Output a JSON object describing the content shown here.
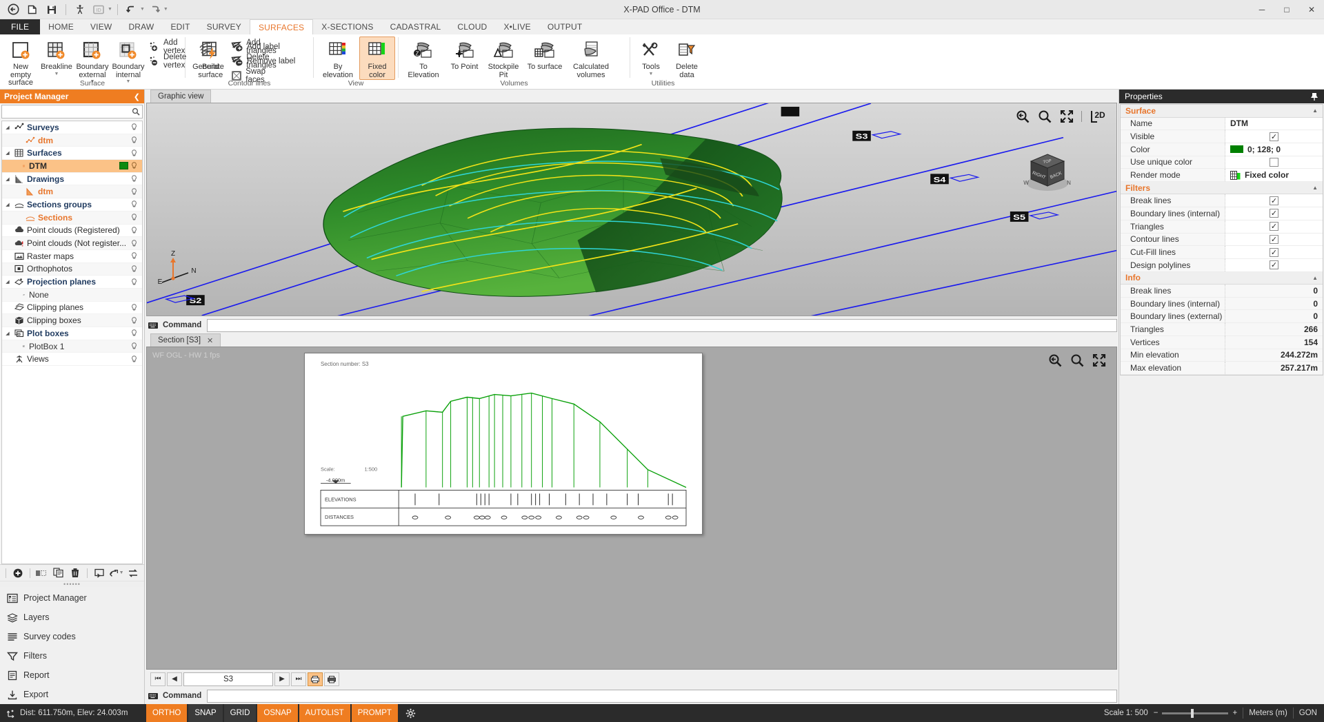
{
  "window": {
    "title": "X-PAD Office - DTM",
    "minimize": "─",
    "maximize": "□",
    "close": "✕"
  },
  "quick_access": [
    {
      "name": "back-icon",
      "label": "Back"
    },
    {
      "name": "new-file-icon",
      "label": "New"
    },
    {
      "name": "save-icon",
      "label": "Save"
    },
    {
      "name": "surveyor-icon",
      "label": "Survey"
    },
    {
      "name": "id-icon",
      "label": "ID"
    },
    {
      "name": "undo-icon",
      "label": "Undo"
    },
    {
      "name": "redo-icon",
      "label": "Redo"
    }
  ],
  "ribbon": {
    "tabs": [
      {
        "label": "FILE",
        "active": false,
        "file": true
      },
      {
        "label": "HOME",
        "active": false
      },
      {
        "label": "VIEW",
        "active": false
      },
      {
        "label": "DRAW",
        "active": false
      },
      {
        "label": "EDIT",
        "active": false
      },
      {
        "label": "SURVEY",
        "active": false
      },
      {
        "label": "SURFACES",
        "active": true
      },
      {
        "label": "X-SECTIONS",
        "active": false
      },
      {
        "label": "CADASTRAL",
        "active": false
      },
      {
        "label": "CLOUD",
        "active": false
      },
      {
        "label": "X•LIVE",
        "active": false
      },
      {
        "label": "OUTPUT",
        "active": false
      }
    ],
    "groups": [
      {
        "label": "Surface",
        "big": [
          {
            "label": "New empty surface",
            "icon": "new-empty-surface-icon",
            "selected": false
          },
          {
            "label": "Breakline",
            "icon": "breakline-icon",
            "dropdown": true,
            "selected": false
          },
          {
            "label": "Boundary external",
            "icon": "boundary-external-icon",
            "dropdown": true,
            "selected": false
          },
          {
            "label": "Boundary internal",
            "icon": "boundary-internal-icon",
            "dropdown": true,
            "selected": false
          }
        ],
        "small": [
          {
            "label": "Add vertex",
            "icon": "add-vertex-icon"
          },
          {
            "label": "Delete vertex",
            "icon": "delete-vertex-icon"
          }
        ],
        "big2": [
          {
            "label": "Build surface",
            "icon": "build-surface-icon",
            "selected": false
          }
        ],
        "small2": [
          {
            "label": "Add triangles",
            "icon": "add-triangles-icon"
          },
          {
            "label": "Delete triangles",
            "icon": "delete-triangles-icon"
          },
          {
            "label": "Swap faces",
            "icon": "swap-faces-icon"
          }
        ]
      },
      {
        "label": "Contour lines",
        "big": [
          {
            "label": "Generate",
            "icon": "generate-contours-icon",
            "selected": false
          }
        ],
        "small": [
          {
            "label": "Add label",
            "icon": "add-label-icon"
          },
          {
            "label": "Remove label",
            "icon": "remove-label-icon"
          }
        ]
      },
      {
        "label": "View",
        "big": [
          {
            "label": "By elevation",
            "icon": "by-elevation-icon",
            "selected": false
          },
          {
            "label": "Fixed color",
            "icon": "fixed-color-icon",
            "selected": true
          }
        ]
      },
      {
        "label": "Volumes",
        "big": [
          {
            "label": "To Elevation",
            "icon": "to-elevation-icon",
            "selected": false
          },
          {
            "label": "To Point",
            "icon": "to-point-icon",
            "selected": false
          },
          {
            "label": "Stockpile Pit",
            "icon": "stockpile-pit-icon",
            "selected": false
          },
          {
            "label": "To surface",
            "icon": "to-surface-icon",
            "selected": false
          },
          {
            "label": "Calculated volumes",
            "icon": "calculated-volumes-icon",
            "selected": false
          }
        ]
      },
      {
        "label": "Utilities",
        "big": [
          {
            "label": "Tools",
            "icon": "tools-icon",
            "dropdown": true,
            "selected": false
          },
          {
            "label": "Delete data",
            "icon": "delete-data-icon",
            "selected": false
          }
        ]
      }
    ]
  },
  "project_manager": {
    "title": "Project Manager",
    "collapse_icon": "chevron-left-icon",
    "search_placeholder": "",
    "search_icon": "search-icon",
    "tree": [
      {
        "label": "Surveys",
        "icon": "surveys-icon",
        "group": true,
        "expanded": true,
        "bulb": true
      },
      {
        "label": "dtm",
        "icon": "survey-item-icon",
        "child": true,
        "bulb": true
      },
      {
        "label": "Surfaces",
        "icon": "surfaces-icon",
        "group": true,
        "expanded": true,
        "bulb": true
      },
      {
        "label": "DTM",
        "icon": "surface-item-icon",
        "child": true,
        "selected": true,
        "swatch": "#008000",
        "bulb": true
      },
      {
        "label": "Drawings",
        "icon": "drawings-icon",
        "group": true,
        "expanded": true,
        "bulb": true
      },
      {
        "label": "dtm",
        "icon": "drawing-item-icon",
        "child": true,
        "bulb": true
      },
      {
        "label": "Sections groups",
        "icon": "sections-groups-icon",
        "group": true,
        "expanded": true,
        "bulb": true
      },
      {
        "label": "Sections",
        "icon": "sections-item-icon",
        "child": true,
        "bulb": true
      },
      {
        "label": "Point clouds (Registered)",
        "icon": "point-cloud-registered-icon",
        "bulb": true
      },
      {
        "label": "Point clouds (Not register...",
        "icon": "point-cloud-unregistered-icon",
        "bulb": true
      },
      {
        "label": "Raster maps",
        "icon": "raster-maps-icon",
        "bulb": true
      },
      {
        "label": "Orthophotos",
        "icon": "orthophotos-icon",
        "bulb": true
      },
      {
        "label": "Projection planes",
        "icon": "projection-planes-icon",
        "group": true,
        "expanded": true,
        "bulb": true
      },
      {
        "label": "None",
        "icon": "projection-none-icon",
        "childplain": true
      },
      {
        "label": "Clipping planes",
        "icon": "clipping-planes-icon",
        "bulb": true
      },
      {
        "label": "Clipping boxes",
        "icon": "clipping-boxes-icon",
        "bulb": true
      },
      {
        "label": "Plot boxes",
        "icon": "plot-boxes-icon",
        "group": true,
        "expanded": true,
        "bulb": true
      },
      {
        "label": "PlotBox 1",
        "icon": "plotbox-item-icon",
        "childplain": true,
        "bulb": true
      },
      {
        "label": "Views",
        "icon": "views-icon",
        "bulb": true
      }
    ],
    "toolbar": [
      {
        "name": "add-button",
        "icon": "plus-circle-icon"
      },
      {
        "name": "cut-button",
        "icon": "cut-icon"
      },
      {
        "name": "copy-button",
        "icon": "copy-icon"
      },
      {
        "name": "delete-button",
        "icon": "trash-icon"
      },
      {
        "name": "paste-button",
        "icon": "paste-icon"
      },
      {
        "name": "move-button",
        "icon": "move-dropdown-icon"
      },
      {
        "name": "refresh-button",
        "icon": "refresh-icon"
      }
    ],
    "nav": [
      {
        "label": "Project Manager",
        "icon": "project-manager-icon"
      },
      {
        "label": "Layers",
        "icon": "layers-icon"
      },
      {
        "label": "Survey codes",
        "icon": "survey-codes-icon"
      },
      {
        "label": "Filters",
        "icon": "filters-icon"
      },
      {
        "label": "Report",
        "icon": "report-icon"
      },
      {
        "label": "Export",
        "icon": "export-icon"
      }
    ]
  },
  "graphic_view": {
    "tab_label": "Graphic view",
    "tools": [
      {
        "name": "zoom-previous-icon",
        "glyph": "previous"
      },
      {
        "name": "zoom-window-icon",
        "glyph": "zoom"
      },
      {
        "name": "zoom-extents-icon",
        "glyph": "extents"
      },
      {
        "name": "view-2d-icon",
        "glyph": "2D"
      }
    ],
    "view_cube": {
      "top": "TOP",
      "front": "RIGHT",
      "side": "BACK",
      "compass_w": "W",
      "compass_n": "N"
    },
    "axis": {
      "z": "Z",
      "n": "N",
      "e": "E"
    },
    "section_markers": [
      "S2",
      "S3",
      "S4",
      "S5"
    ],
    "command": {
      "label": "Command",
      "icon": "command-icon",
      "value": ""
    }
  },
  "section_panel": {
    "tab_label": "Section [S3]",
    "tab_close": "✕",
    "status": "WF OGL - HW   1  fps",
    "drawing": {
      "title": "Section number: S3",
      "scale_label": "Scale:",
      "scale_value": "1:500",
      "elev_label": "-4.000m",
      "row1_label": "ELEVATIONS",
      "row2_label": "DISTANCES"
    },
    "tools": [
      {
        "name": "zoom-previous-icon"
      },
      {
        "name": "zoom-window-icon"
      },
      {
        "name": "zoom-extents-icon"
      }
    ],
    "nav": {
      "first": "⏮",
      "prev": "◀",
      "value": "S3",
      "next": "▶",
      "last": "⏭",
      "print_preview_icon": "print-preview-icon",
      "print_icon": "printer-icon"
    },
    "command": {
      "label": "Command",
      "icon": "command-icon",
      "value": ""
    }
  },
  "properties": {
    "title": "Properties",
    "pin_icon": "pin-icon",
    "sections": [
      {
        "title": "Surface",
        "rows": [
          {
            "key": "Name",
            "value": "DTM",
            "type": "text",
            "bold": true
          },
          {
            "key": "Visible",
            "value": "✓",
            "type": "checkbox",
            "checked": true
          },
          {
            "key": "Color",
            "value": "0; 128; 0",
            "type": "color",
            "swatch": "#008000"
          },
          {
            "key": "Use unique color",
            "value": "",
            "type": "checkbox",
            "checked": false
          },
          {
            "key": "Render mode",
            "value": "Fixed color",
            "type": "icontext",
            "icon": "fixed-color-icon"
          }
        ]
      },
      {
        "title": "Filters",
        "rows": [
          {
            "key": "Break lines",
            "value": "✓",
            "type": "checkbox",
            "checked": true
          },
          {
            "key": "Boundary lines (internal)",
            "value": "✓",
            "type": "checkbox",
            "checked": true
          },
          {
            "key": "Triangles",
            "value": "✓",
            "type": "checkbox",
            "checked": true
          },
          {
            "key": "Contour lines",
            "value": "✓",
            "type": "checkbox",
            "checked": true
          },
          {
            "key": "Cut-Fill lines",
            "value": "✓",
            "type": "checkbox",
            "checked": true
          },
          {
            "key": "Design polylines",
            "value": "✓",
            "type": "checkbox",
            "checked": true
          }
        ]
      },
      {
        "title": "Info",
        "rows": [
          {
            "key": "Break lines",
            "value": "0",
            "type": "number"
          },
          {
            "key": "Boundary lines (internal)",
            "value": "0",
            "type": "number"
          },
          {
            "key": "Boundary lines (external)",
            "value": "0",
            "type": "number"
          },
          {
            "key": "Triangles",
            "value": "266",
            "type": "number"
          },
          {
            "key": "Vertices",
            "value": "154",
            "type": "number"
          },
          {
            "key": "Min elevation",
            "value": "244.272m",
            "type": "number"
          },
          {
            "key": "Max elevation",
            "value": "257.217m",
            "type": "number"
          }
        ]
      }
    ]
  },
  "statusbar": {
    "coords_icon": "coordinates-icon",
    "coords": "Dist: 611.750m, Elev: 24.003m",
    "toggles": [
      {
        "label": "ORTHO",
        "on": true
      },
      {
        "label": "SNAP",
        "on": false
      },
      {
        "label": "GRID",
        "on": false
      },
      {
        "label": "OSNAP",
        "on": true
      },
      {
        "label": "AUTOLIST",
        "on": true
      },
      {
        "label": "PROMPT",
        "on": true
      }
    ],
    "settings_icon": "gear-icon",
    "scale_label": "Scale 1: 500",
    "zoom_out": "−",
    "zoom_in": "+",
    "units": "Meters (m)",
    "angle_units": "GON"
  }
}
